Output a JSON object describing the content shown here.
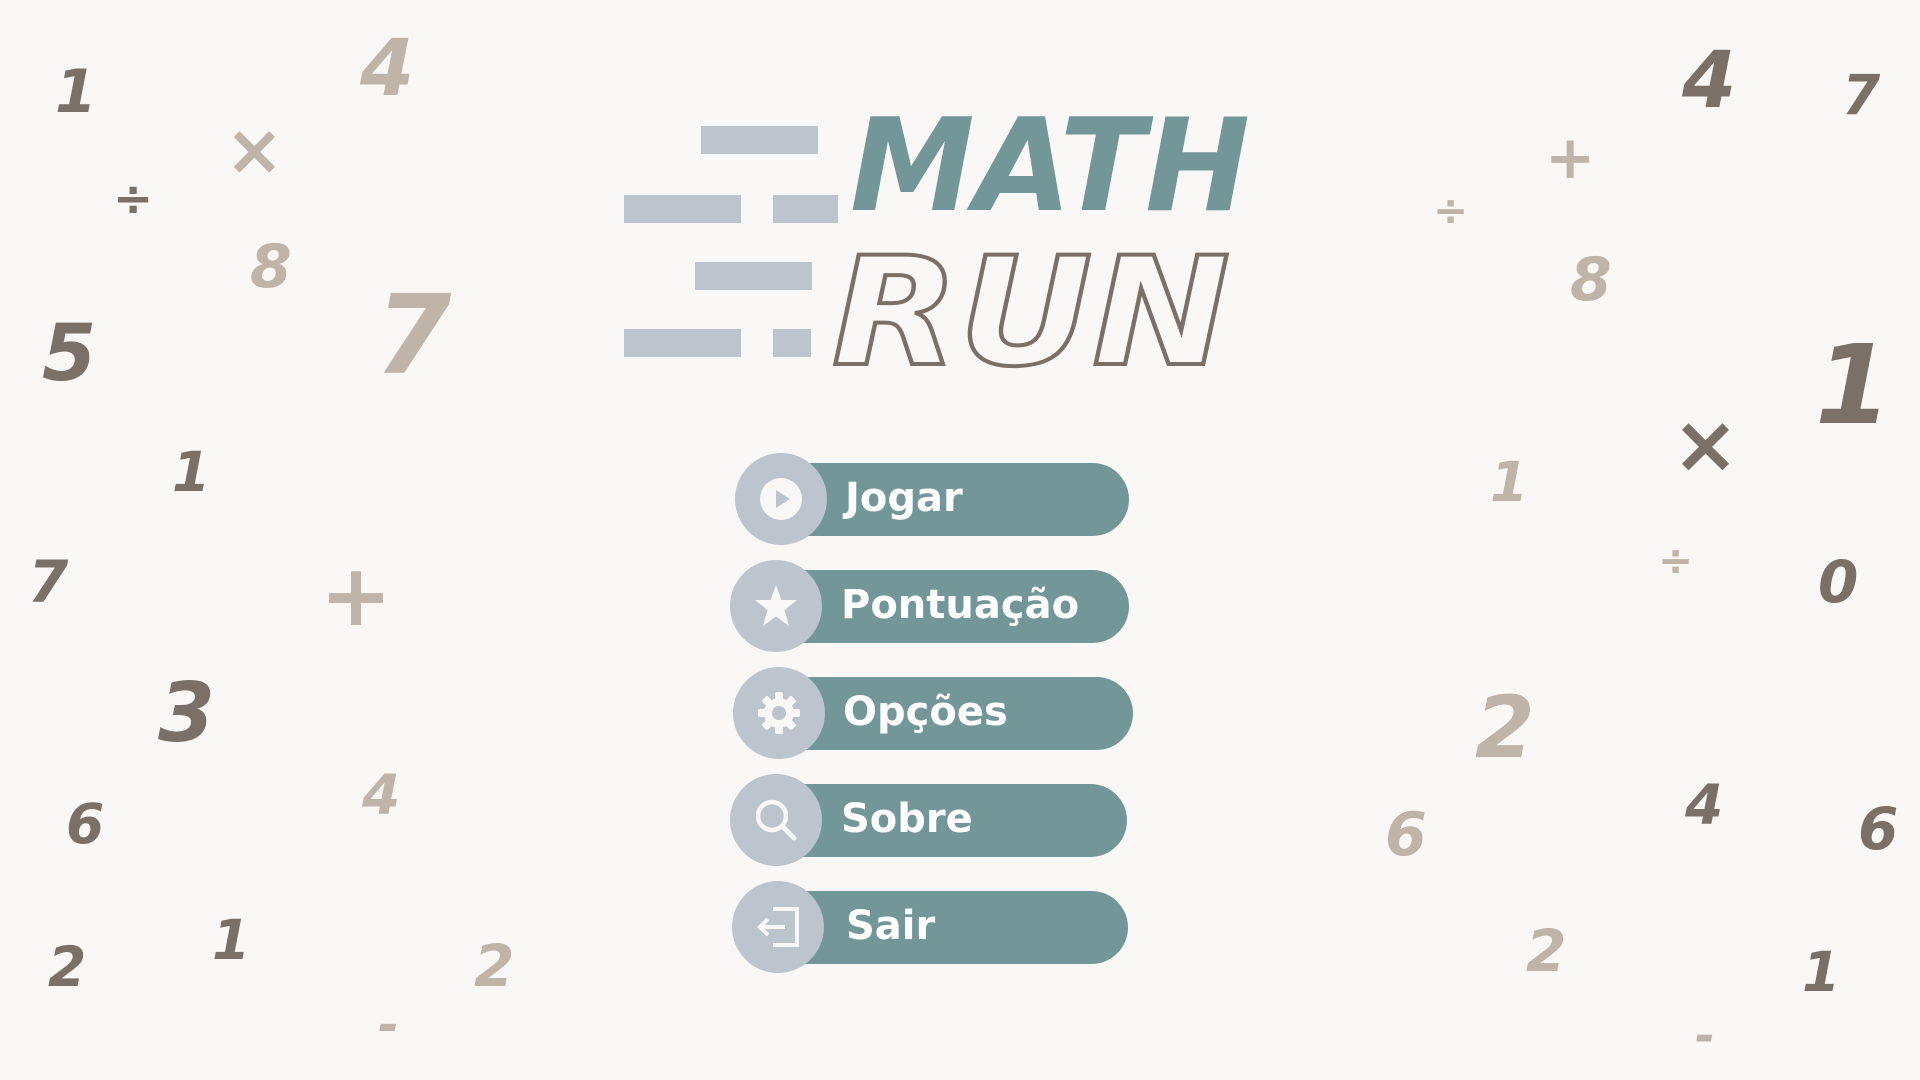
{
  "title": {
    "line1": "MATH",
    "line2": "RUN"
  },
  "menu": {
    "items": [
      {
        "label": "Jogar",
        "icon": "play-icon"
      },
      {
        "label": "Pontuação",
        "icon": "star-icon"
      },
      {
        "label": "Opções",
        "icon": "gear-icon"
      },
      {
        "label": "Sobre",
        "icon": "magnifier-icon"
      },
      {
        "label": "Sair",
        "icon": "exit-icon"
      }
    ]
  },
  "colors": {
    "background": "#f9f8f6",
    "teal": "#739698",
    "slate": "#bcc4ce",
    "dark_glyph": "#7a7067",
    "light_glyph": "#bfb4a7"
  },
  "background_glyphs": [
    "1",
    "4",
    "×",
    "÷",
    "8",
    "7",
    "5",
    "1",
    "7",
    "+",
    "3",
    "4",
    "6",
    "2",
    "1",
    "2",
    "-",
    "4",
    "7",
    "+",
    "÷",
    "8",
    "1",
    "×",
    "1",
    "÷",
    "0",
    "2",
    "6",
    "4",
    "6",
    "2",
    "1",
    "-"
  ]
}
